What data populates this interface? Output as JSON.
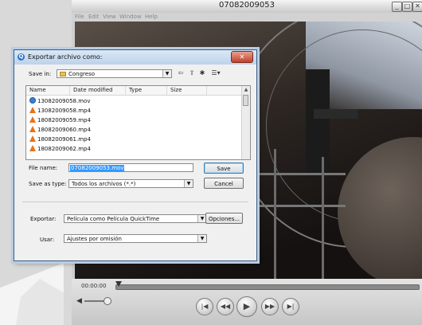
{
  "player": {
    "title": "07082009053",
    "menus": [
      "File",
      "Edit",
      "View",
      "Window",
      "Help"
    ],
    "time": "00:00:00",
    "window_buttons": {
      "minimize": "_",
      "maximize": "□",
      "close": "✕"
    }
  },
  "dialog": {
    "title": "Exportar archivo como:",
    "close_label": "✕",
    "save_in_label": "Save in:",
    "save_in_value": "Congreso",
    "columns": [
      "Name",
      "Date modified",
      "Type",
      "Size"
    ],
    "files": [
      {
        "name": "13082009058.mov",
        "icon": "quicktime-file-icon"
      },
      {
        "name": "13082009058.mp4",
        "icon": "vlc-file-icon"
      },
      {
        "name": "18082009059.mp4",
        "icon": "vlc-file-icon"
      },
      {
        "name": "18082009060.mp4",
        "icon": "vlc-file-icon"
      },
      {
        "name": "18082009061.mp4",
        "icon": "vlc-file-icon"
      },
      {
        "name": "18082009062.mp4",
        "icon": "vlc-file-icon"
      }
    ],
    "file_name_label": "File name:",
    "file_name_value": "07082009053.mov",
    "save_as_type_label": "Save as type:",
    "save_as_type_value": "Todos los archivos (*.*)",
    "save_button": "Save",
    "cancel_button": "Cancel",
    "export_label": "Exportar:",
    "export_value": "Película como Película QuickTime",
    "options_button": "Opciones...",
    "use_label": "Usar:",
    "use_value": "Ajustes por omisión"
  }
}
